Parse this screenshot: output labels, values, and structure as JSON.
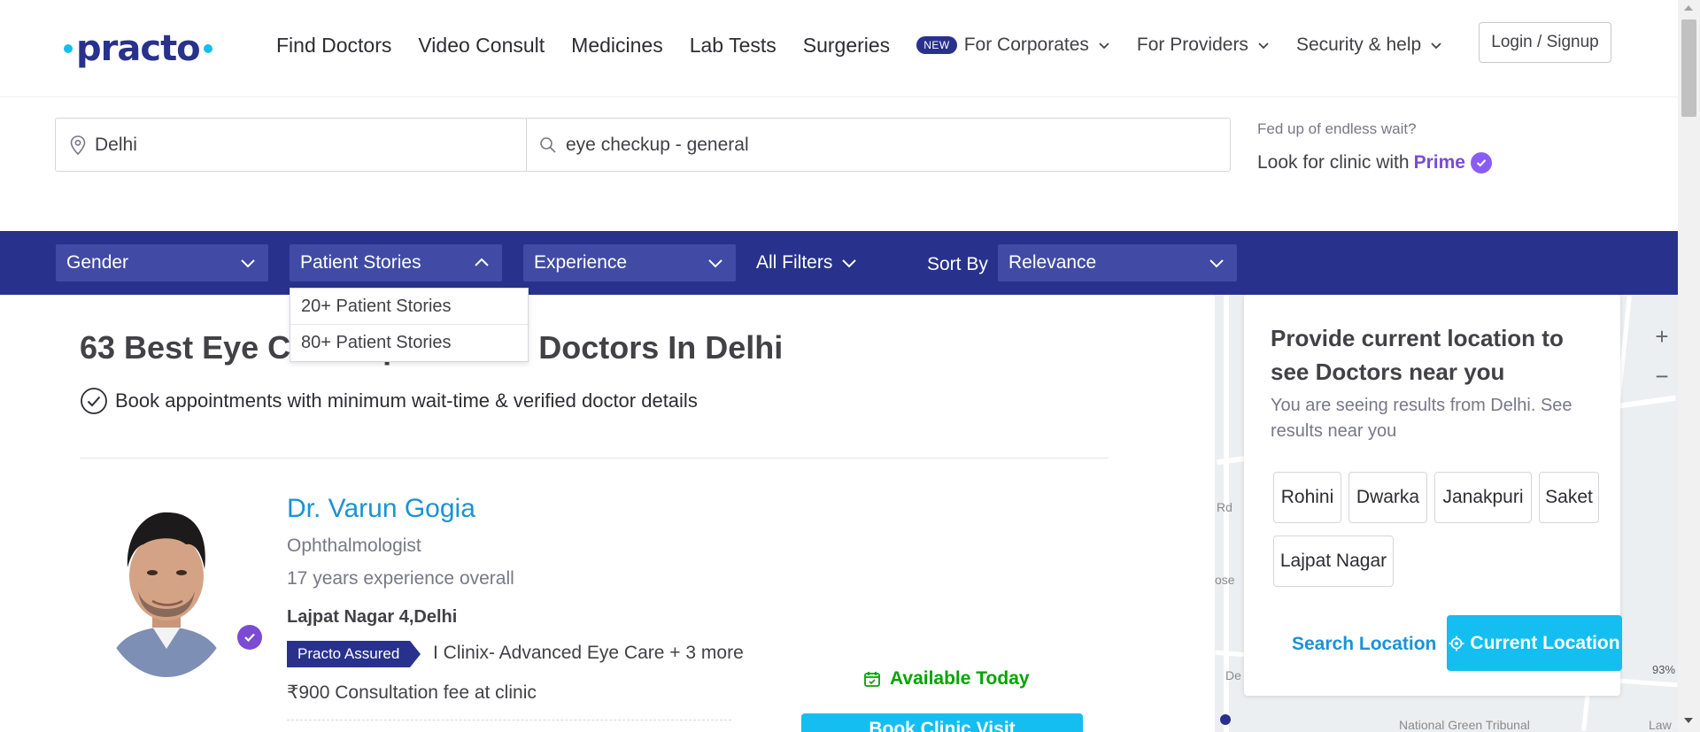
{
  "header": {
    "logo_text": "practo",
    "nav": [
      "Find Doctors",
      "Video Consult",
      "Medicines",
      "Lab Tests",
      "Surgeries"
    ],
    "new_badge": "NEW",
    "for_corporates": "For Corporates",
    "for_providers": "For Providers",
    "security_help": "Security & help",
    "login": "Login / Signup"
  },
  "search": {
    "location_value": "Delhi",
    "query_value": "eye checkup - general",
    "prime_sub": "Fed up of endless wait?",
    "prime_main": "Look for clinic with",
    "prime_word": "Prime"
  },
  "filters": {
    "gender": "Gender",
    "patient_stories": "Patient Stories",
    "experience": "Experience",
    "all_filters": "All Filters",
    "sort_by": "Sort By",
    "sort_value": "Relevance",
    "patient_stories_options": [
      "20+ Patient Stories",
      "80+ Patient Stories"
    ]
  },
  "results": {
    "title": "63 Best Eye Checkup General Doctors In Delhi",
    "subtitle": "Book appointments with minimum wait-time & verified doctor details"
  },
  "doctor": {
    "name": "Dr. Varun Gogia",
    "specialty": "Ophthalmologist",
    "experience": "17 years experience overall",
    "location": "Lajpat Nagar 4,Delhi",
    "assured_badge": "Practo Assured",
    "clinic": "I Clinix- Advanced Eye Care + 3 more",
    "fee": "₹900 Consultation fee at clinic",
    "availability": "Available Today",
    "book_label": "Book Clinic Visit"
  },
  "location_card": {
    "title": "Provide current location to see Doctors near you",
    "subtitle": "You are seeing results from Delhi. See results near you",
    "chips": [
      "Rohini",
      "Dwarka",
      "Janakpuri",
      "Saket",
      "Lajpat Nagar"
    ],
    "search_location": "Search Location",
    "current_location": "Current Location"
  },
  "map": {
    "zoom_in": "+",
    "zoom_out": "−",
    "labels": [
      "Rd",
      "ose",
      "De",
      "National Green Tribunal",
      "Law",
      "93%"
    ]
  },
  "colors": {
    "brand_navy": "#28328c",
    "brand_cyan": "#14bef0",
    "link_blue": "#1a93d3",
    "available_green": "#01a400",
    "prime_purple": "#7b4bd3"
  }
}
